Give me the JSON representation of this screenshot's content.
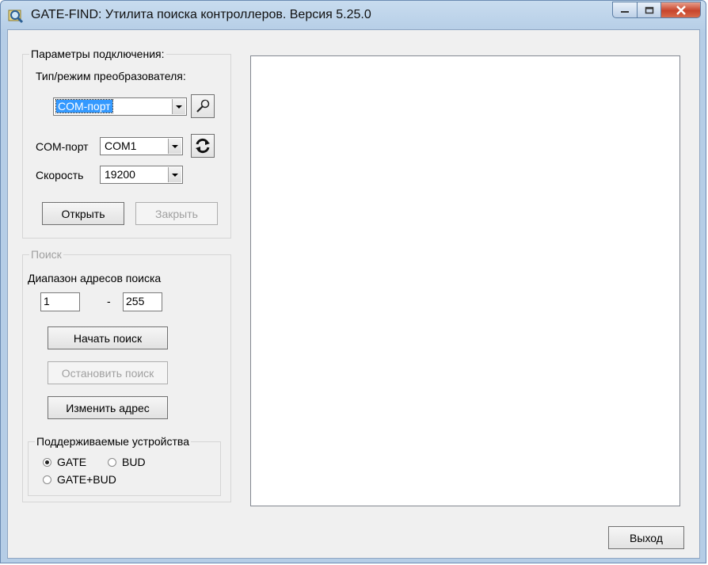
{
  "window": {
    "title": "GATE-FIND: Утилита поиска контроллеров. Версия 5.25.0",
    "icon": "magnifier-icon"
  },
  "connection": {
    "legend": "Параметры подключения:",
    "converter_label": "Тип/режим преобразователя:",
    "converter_value": "COM-порт",
    "port_label": "COM-порт",
    "port_value": "COM1",
    "speed_label": "Скорость",
    "speed_value": "19200",
    "open_button": "Открыть",
    "close_button": "Закрыть"
  },
  "search": {
    "legend": "Поиск",
    "range_label": "Диапазон адресов поиска",
    "range_from": "1",
    "range_dash": "-",
    "range_to": "255",
    "start_button": "Начать поиск",
    "stop_button": "Остановить поиск",
    "change_address_button": "Изменить адрес"
  },
  "devices": {
    "legend": "Поддерживаемые устройства",
    "options": [
      {
        "label": "GATE",
        "selected": true
      },
      {
        "label": "BUD",
        "selected": false
      },
      {
        "label": "GATE+BUD",
        "selected": false
      }
    ]
  },
  "footer": {
    "exit_button": "Выход"
  },
  "colors": {
    "selection": "#3399ff",
    "close_button": "#c7452c",
    "window_frame": "#b5cde6"
  }
}
